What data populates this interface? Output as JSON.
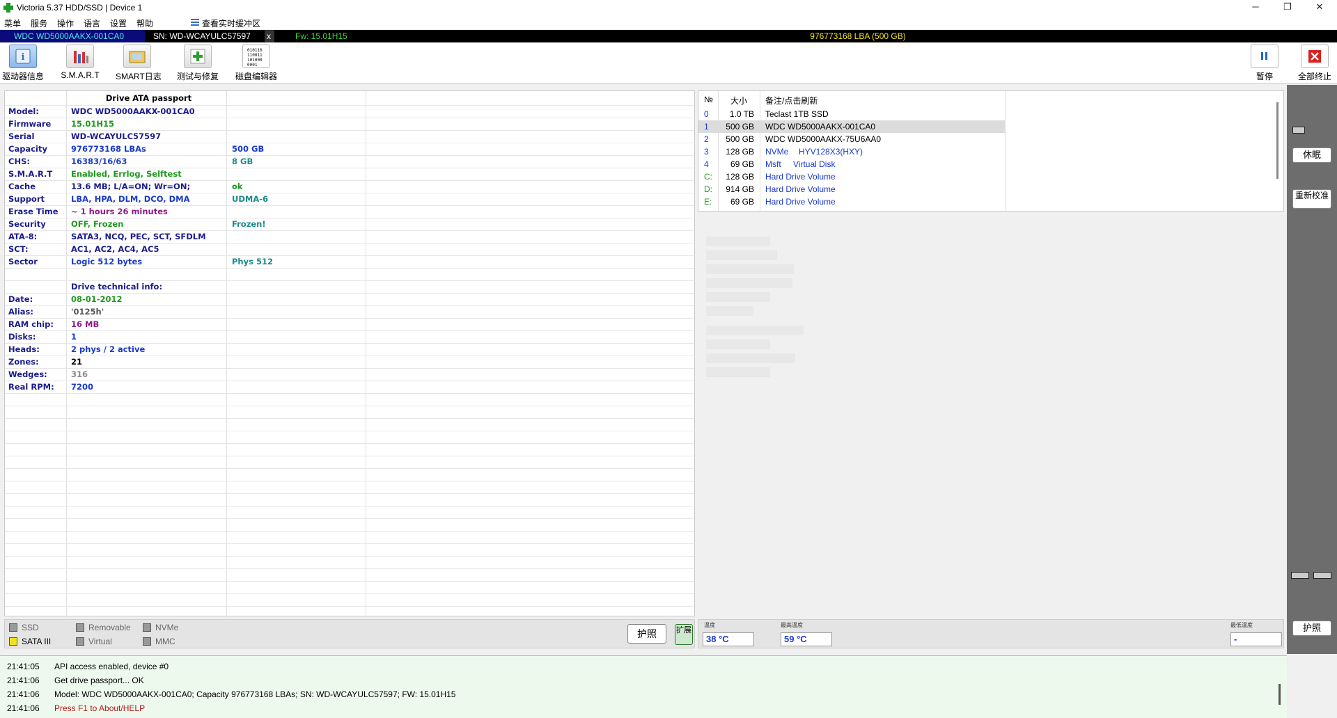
{
  "window": {
    "title": "Victoria 5.37 HDD/SSD | Device 1",
    "minimize": "─",
    "maximize": "❐",
    "close": "✕"
  },
  "menu": [
    "菜单",
    "服务",
    "操作",
    "语言",
    "设置",
    "帮助"
  ],
  "buffer_link": "查看实时缓冲区",
  "strip": {
    "model": "WDC WD5000AAKX-001CA0",
    "serial": "SN: WD-WCAYULC57597",
    "close": "x",
    "fw": "Fw: 15.01H15",
    "lba": "976773168 LBA (500 GB)"
  },
  "toolbar": {
    "drive_info": "驱动器信息",
    "smart": "S.M.A.R.T",
    "smart_log": "SMART日志",
    "test_repair": "测试与修复",
    "disk_editor": "磁盘编辑器",
    "disk_editor_icon_text": "010110\n110011\n101000\n0001",
    "pause": "暂停",
    "stop_all": "全部终止"
  },
  "passport": {
    "header": "Drive ATA passport",
    "rows": [
      {
        "label": "Model:",
        "value": "WDC WD5000AAKX-001CA0",
        "extra": "",
        "color": "#1c1c8c"
      },
      {
        "label": "Firmware",
        "value": "15.01H15",
        "extra": "",
        "color": "#1e9a1e"
      },
      {
        "label": "Serial",
        "value": "WD-WCAYULC57597",
        "extra": "",
        "color": "#1c1c8c"
      },
      {
        "label": "Capacity",
        "value": "976773168 LBAs",
        "extra": "500 GB",
        "color": "#1a3acc",
        "extra_color": "#1a3acc"
      },
      {
        "label": "CHS:",
        "value": "16383/16/63",
        "extra": "8 GB",
        "color": "#1a3acc",
        "extra_color": "#1a8a8a"
      },
      {
        "label": "S.M.A.R.T",
        "value": "Enabled, Errlog, Selftest",
        "extra": "",
        "color": "#1e9a1e"
      },
      {
        "label": "Cache",
        "value": "13.6 MB; L/A=ON; Wr=ON;",
        "extra": "ok",
        "color": "#1c1c8c",
        "extra_color": "#1e9a1e"
      },
      {
        "label": "Support",
        "value": "LBA, HPA, DLM, DCO, DMA",
        "extra": "UDMA-6",
        "color": "#1a3acc",
        "extra_color": "#1a8a8a"
      },
      {
        "label": "Erase Time",
        "value": "~ 1 hours 26 minutes",
        "extra": "",
        "color": "#8a1a8a"
      },
      {
        "label": "Security",
        "value": "OFF, Frozen",
        "extra": "Frozen!",
        "color": "#1e9a1e",
        "extra_color": "#1a8a8a"
      },
      {
        "label": "ATA-8:",
        "value": "SATA3, NCQ, PEC, SCT, SFDLM",
        "extra": "",
        "color": "#1c1c8c"
      },
      {
        "label": "SCT:",
        "value": "AC1, AC2, AC4, AC5",
        "extra": "",
        "color": "#1c1c8c"
      },
      {
        "label": "Sector",
        "value": "Logic 512 bytes",
        "extra": "Phys 512",
        "color": "#1a3acc",
        "extra_color": "#1a8a8a"
      },
      {
        "label": "",
        "value": "",
        "extra": "",
        "color": "#000"
      },
      {
        "label": "",
        "value": "Drive technical info:",
        "extra": "",
        "color": "#1c1c8c"
      },
      {
        "label": "Date:",
        "value": "08-01-2012",
        "extra": "",
        "color": "#1e9a1e"
      },
      {
        "label": "Alias:",
        "value": "'0125h'",
        "extra": "",
        "color": "#555555"
      },
      {
        "label": "RAM chip:",
        "value": "16 MB",
        "extra": "",
        "color": "#8a1a8a"
      },
      {
        "label": "Disks:",
        "value": "1",
        "extra": "",
        "color": "#1a3acc"
      },
      {
        "label": "Heads:",
        "value": "2 phys / 2 active",
        "extra": "",
        "color": "#1a3acc"
      },
      {
        "label": "Zones:",
        "value": "21",
        "extra": "",
        "color": "#000000"
      },
      {
        "label": "Wedges:",
        "value": "316",
        "extra": "",
        "color": "#888888"
      },
      {
        "label": "Real RPM:",
        "value": "7200",
        "extra": "",
        "color": "#1a3acc"
      }
    ]
  },
  "legend": {
    "ssd": "SSD",
    "removable": "Removable",
    "nvme": "NVMe",
    "sata": "SATA III",
    "virtual": "Virtual",
    "mmc": "MMC",
    "passport_btn": "护照",
    "ext_btn": "扩展"
  },
  "devices": {
    "headers": {
      "num": "№",
      "size": "大小",
      "note": "备注/点击刷新"
    },
    "rows": [
      {
        "num": "0",
        "size": "1.0 TB",
        "type": "",
        "name": "Teclast 1TB SSD",
        "num_color": "#1a3acc",
        "name_color": "#000000"
      },
      {
        "num": "1",
        "size": "500 GB",
        "type": "",
        "name": "WDC WD5000AAKX-001CA0",
        "num_color": "#1a3acc",
        "name_color": "#000000",
        "selected": true
      },
      {
        "num": "2",
        "size": "500 GB",
        "type": "",
        "name": "WDC WD5000AAKX-75U6AA0",
        "num_color": "#1a3acc",
        "name_color": "#000000"
      },
      {
        "num": "3",
        "size": "128 GB",
        "type": "NVMe",
        "name": "HYV128X3(HXY)",
        "num_color": "#1a3acc",
        "name_color": "#1a3acc"
      },
      {
        "num": "4",
        "size": "69 GB",
        "type": "Msft",
        "name": "Virtual Disk",
        "num_color": "#1a3acc",
        "name_color": "#1a3acc"
      },
      {
        "num": "C:",
        "size": "128 GB",
        "type": "",
        "name": "Hard Drive Volume",
        "num_color": "#1e9a1e",
        "name_color": "#1a3acc"
      },
      {
        "num": "D:",
        "size": "914 GB",
        "type": "",
        "name": "Hard Drive Volume",
        "num_color": "#1e9a1e",
        "name_color": "#1a3acc"
      },
      {
        "num": "E:",
        "size": "69 GB",
        "type": "",
        "name": "Hard Drive Volume",
        "num_color": "#1e9a1e",
        "name_color": "#1a3acc"
      }
    ]
  },
  "temps": {
    "temp_label": "温度",
    "temp_value": "38 °C",
    "max_label": "最高温度",
    "max_value": "59 °C",
    "min_label": "最低温度",
    "min_value": "-"
  },
  "side": {
    "sleep": "休眠",
    "recalibrate": "重新校准",
    "passport": "护照"
  },
  "log": [
    {
      "time": "21:41:05",
      "msg": "API access enabled, device #0",
      "color": "#000000"
    },
    {
      "time": "21:41:06",
      "msg": "Get drive passport... OK",
      "color": "#000000"
    },
    {
      "time": "21:41:06",
      "msg": "Model: WDC WD5000AAKX-001CA0; Capacity 976773168 LBAs; SN: WD-WCAYULC57597; FW: 15.01H15",
      "color": "#000000"
    },
    {
      "time": "21:41:06",
      "msg": "Press F1 to About/HELP",
      "color": "#b01818"
    }
  ]
}
